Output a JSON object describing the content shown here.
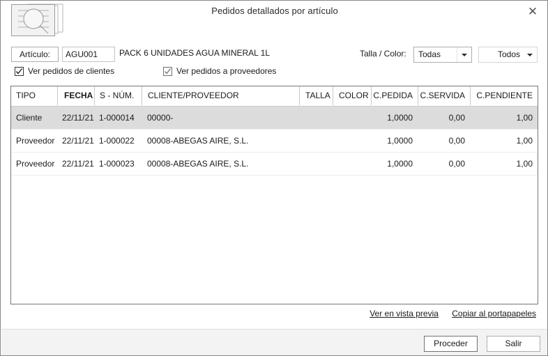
{
  "window": {
    "title": "Pedidos detallados por artículo",
    "close_label": "✕",
    "icon": "document-search-icon"
  },
  "filters": {
    "article_label": "Artículo:",
    "article_value": "AGU001",
    "article_placeholder": "",
    "article_description": "PACK 6 UNIDADES AGUA MINERAL 1L",
    "size_color_label": "Talla / Color:",
    "size_value": "Todas",
    "color_value": "Todos",
    "checkbox_clients": "Ver pedidos de clientes",
    "checkbox_clients_checked": true,
    "checkbox_suppliers": "Ver pedidos a proveedores",
    "checkbox_suppliers_checked": true
  },
  "grid": {
    "columns": [
      "TIPO",
      "FECHA",
      "S - NÚM.",
      "CLIENTE/PROVEEDOR",
      "TALLA",
      "COLOR",
      "C.PEDIDA",
      "C.SERVIDA",
      "C.PENDIENTE"
    ],
    "rows": [
      {
        "tipo": "Cliente",
        "fecha": "22/11/21",
        "snum": "1-000014",
        "cliente_proveedor": "00000-",
        "talla": "",
        "color": "",
        "cpedida": "1,0000",
        "cservida": "0,00",
        "cpendiente": "1,00",
        "selected": true
      },
      {
        "tipo": "Proveedor",
        "fecha": "22/11/21",
        "snum": "1-000022",
        "cliente_proveedor": "00008-ABEGAS AIRE, S.L.",
        "talla": "",
        "color": "",
        "cpedida": "1,0000",
        "cservida": "0,00",
        "cpendiente": "1,00",
        "selected": false
      },
      {
        "tipo": "Proveedor",
        "fecha": "22/11/21",
        "snum": "1-000023",
        "cliente_proveedor": "00008-ABEGAS AIRE, S.L.",
        "talla": "",
        "color": "",
        "cpedida": "1,0000",
        "cservida": "0,00",
        "cpendiente": "1,00",
        "selected": false
      }
    ]
  },
  "links": {
    "preview": "Ver en vista previa",
    "clipboard": "Copiar al portapapeles"
  },
  "footer": {
    "proceed": "Proceder",
    "exit": "Salir"
  },
  "colors": {
    "window_border": "#888888",
    "grid_border": "#767676",
    "selected_row": "#dcdcdc",
    "footer_bg": "#f3f3f3",
    "text": "#1a1a1a"
  }
}
